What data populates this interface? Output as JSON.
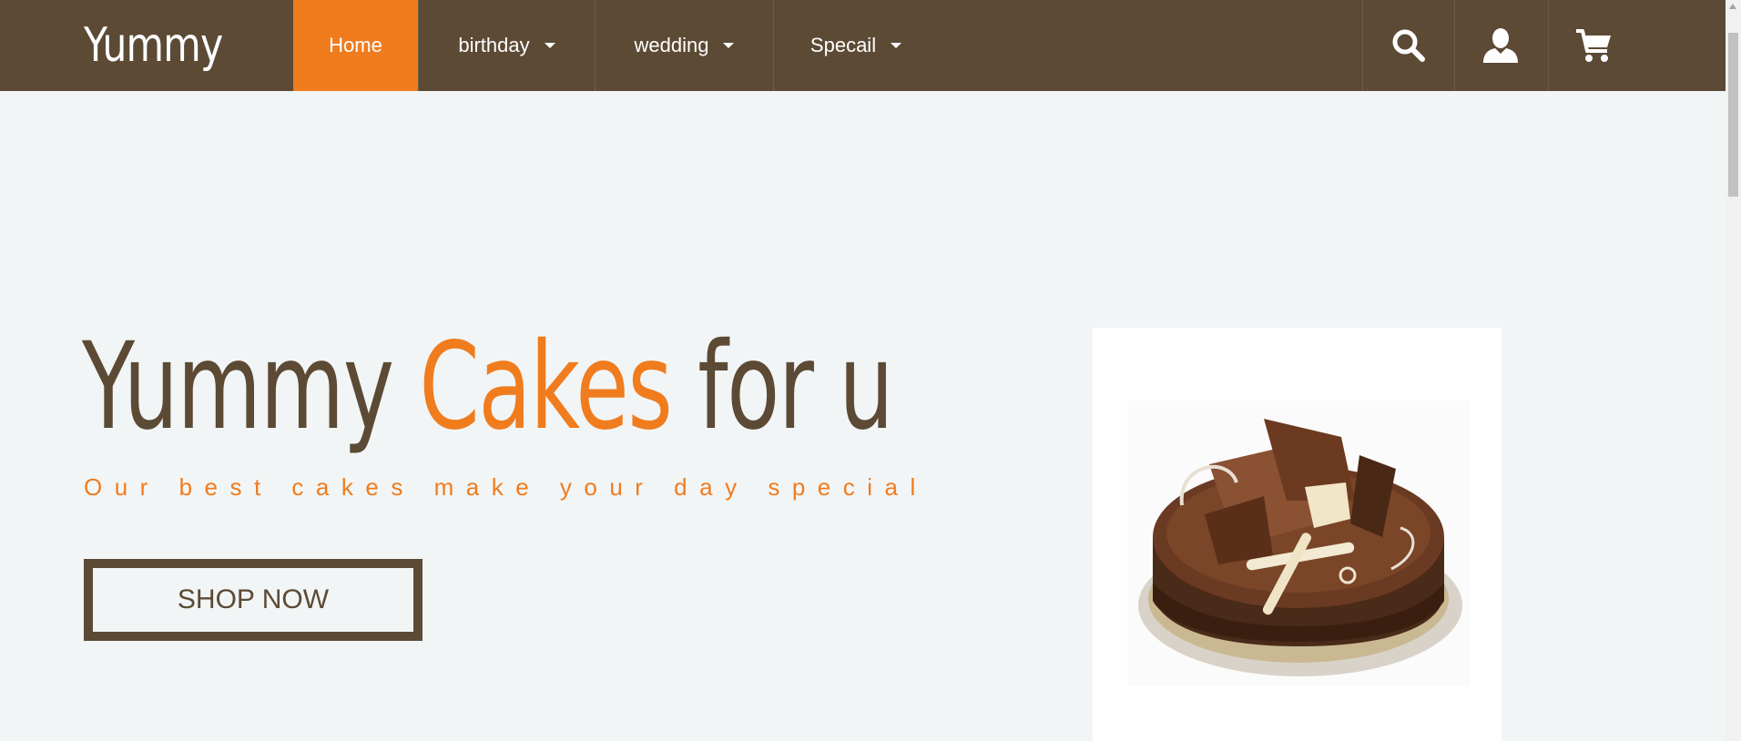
{
  "brand": {
    "name": "Yummy"
  },
  "nav": {
    "items": [
      {
        "label": "Home",
        "active": true,
        "has_dropdown": false
      },
      {
        "label": "birthday",
        "active": false,
        "has_dropdown": true
      },
      {
        "label": "wedding",
        "active": false,
        "has_dropdown": true
      },
      {
        "label": "Specail",
        "active": false,
        "has_dropdown": true
      }
    ],
    "icons": [
      "search-icon",
      "user-icon",
      "cart-icon"
    ]
  },
  "hero": {
    "title_part1": "Yummy ",
    "title_accent": "Cakes",
    "title_part2": " for u",
    "tagline": "Our best cakes make your day special",
    "cta_label": "SHOP NOW"
  },
  "colors": {
    "nav_bg": "#5c4a35",
    "accent": "#f07c1e",
    "page_bg": "#f1f5f6",
    "text_dark": "#5c4a35"
  }
}
